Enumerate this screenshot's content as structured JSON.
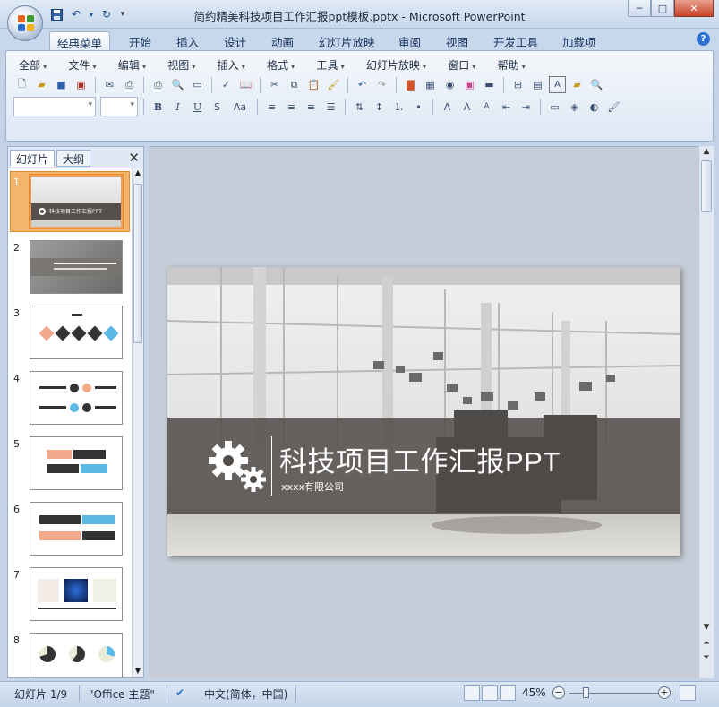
{
  "window": {
    "title": "简约精美科技项目工作汇报ppt模板.pptx - Microsoft PowerPoint",
    "minimize": "─",
    "maximize": "□",
    "close": "✕"
  },
  "ribbon_tabs": [
    "经典菜单",
    "开始",
    "插入",
    "设计",
    "动画",
    "幻灯片放映",
    "审阅",
    "视图",
    "开发工具",
    "加载项"
  ],
  "menus": [
    "全部",
    "文件",
    "编辑",
    "视图",
    "插入",
    "格式",
    "工具",
    "幻灯片放映",
    "窗口",
    "帮助"
  ],
  "format_buttons": {
    "bold": "B",
    "italic": "I",
    "underline": "U",
    "shadow": "S",
    "case": "Aa",
    "font_color": "A"
  },
  "panel": {
    "tab_slides": "幻灯片",
    "tab_outline": "大纲",
    "close": "✕",
    "thumbnails": [
      {
        "num": "1",
        "title": "科技项目工作汇报PPT"
      },
      {
        "num": "2"
      },
      {
        "num": "3"
      },
      {
        "num": "4"
      },
      {
        "num": "5"
      },
      {
        "num": "6"
      },
      {
        "num": "7"
      },
      {
        "num": "8"
      }
    ]
  },
  "slide": {
    "title": "科技项目工作汇报PPT",
    "subtitle": "xxxx有限公司"
  },
  "status": {
    "slide_indicator": "幻灯片 1/9",
    "theme": "\"Office 主题\"",
    "language": "中文(简体，中国)",
    "zoom": "45%",
    "zoom_minus": "−",
    "zoom_plus": "+"
  },
  "colors": {
    "ribbon_bg": "#dde7f4",
    "selected_thumb": "#f4b46c",
    "slide_band": "#524c48",
    "accent_blue": "#2e6fd0"
  }
}
